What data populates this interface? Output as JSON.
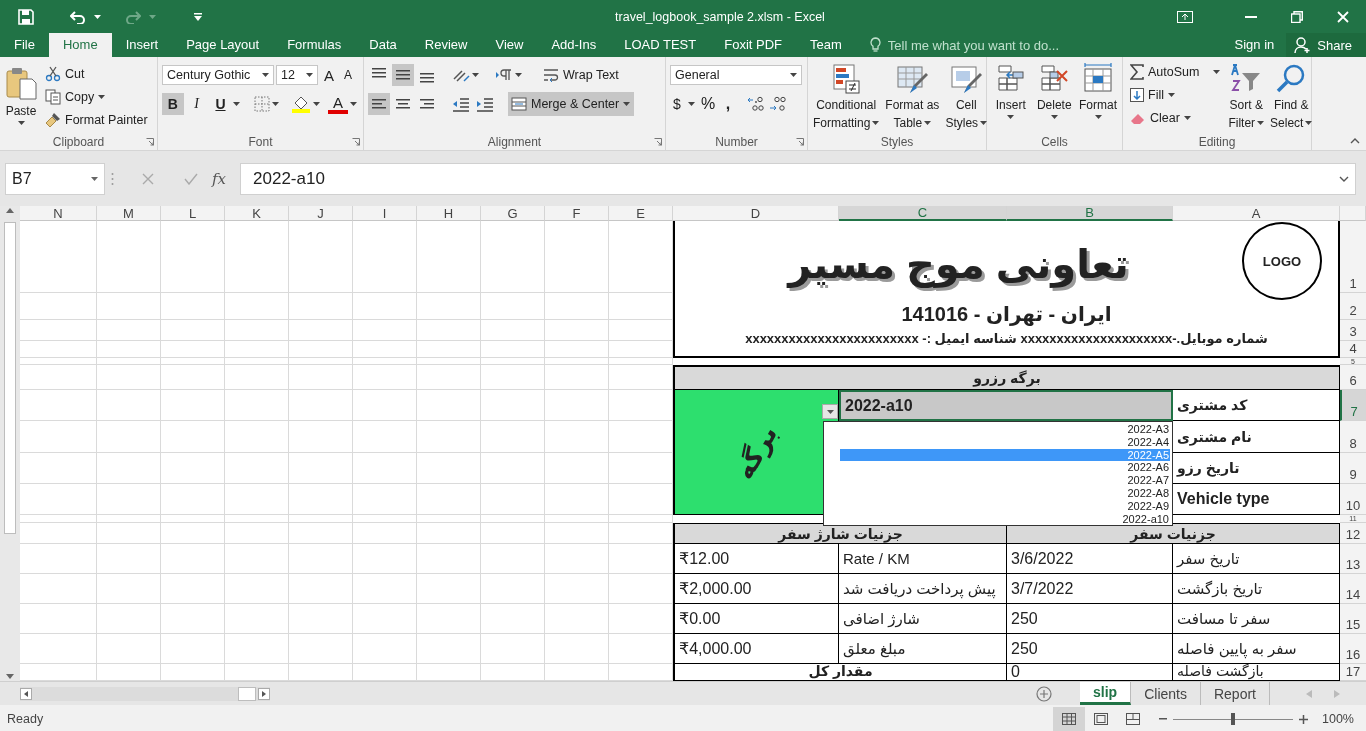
{
  "title_bar": {
    "title": "travel_logbook_sample 2.xlsm - Excel"
  },
  "menu_tabs": [
    {
      "label": "File",
      "selected": false
    },
    {
      "label": "Home",
      "selected": true
    },
    {
      "label": "Insert",
      "selected": false
    },
    {
      "label": "Page Layout",
      "selected": false
    },
    {
      "label": "Formulas",
      "selected": false
    },
    {
      "label": "Data",
      "selected": false
    },
    {
      "label": "Review",
      "selected": false
    },
    {
      "label": "View",
      "selected": false
    },
    {
      "label": "Add-Ins",
      "selected": false
    },
    {
      "label": "LOAD TEST",
      "selected": false
    },
    {
      "label": "Foxit PDF",
      "selected": false
    },
    {
      "label": "Team",
      "selected": false
    }
  ],
  "tell_me": {
    "placeholder": "Tell me what you want to do..."
  },
  "account": {
    "sign_in": "Sign in",
    "share": "Share"
  },
  "ribbon": {
    "clipboard": {
      "label": "Clipboard",
      "paste": "Paste",
      "cut": "Cut",
      "copy": "Copy",
      "format_painter": "Format Painter"
    },
    "font": {
      "label": "Font",
      "name": "Century Gothic",
      "size": "12",
      "grow": "A",
      "shrink": "A",
      "bold": "B",
      "italic": "I",
      "underline": "U",
      "font_color": "A",
      "bold_on": true
    },
    "alignment": {
      "label": "Alignment",
      "wrap_text": "Wrap Text",
      "merge_center": "Merge & Center",
      "middle_on": true,
      "left_on": true,
      "merge_on": true
    },
    "number": {
      "label": "Number",
      "format": "General",
      "currency": "$",
      "percent": "%",
      "comma": ","
    },
    "styles": {
      "label": "Styles",
      "buttons": [
        {
          "kind": "conditional",
          "line1": "Conditional",
          "line2": "Formatting"
        },
        {
          "kind": "table",
          "line1": "Format as",
          "line2": "Table"
        },
        {
          "kind": "cell_styles",
          "line1": "Cell",
          "line2": "Styles"
        }
      ]
    },
    "cells": {
      "label": "Cells",
      "buttons": [
        {
          "kind": "insert",
          "label": "Insert"
        },
        {
          "kind": "delete",
          "label": "Delete"
        },
        {
          "kind": "format",
          "label": "Format"
        }
      ]
    },
    "editing": {
      "label": "Editing",
      "autosum": "AutoSum",
      "fill": "Fill",
      "clear": "Clear",
      "sort_line1": "Sort &",
      "sort_line2": "Filter",
      "find_line1": "Find &",
      "find_line2": "Select"
    }
  },
  "formula_bar": {
    "name_box": "B7",
    "fx": "fx",
    "value": "2022-a10"
  },
  "sheet": {
    "columns": [
      {
        "label": "N",
        "selected": false
      },
      {
        "label": "M",
        "selected": false
      },
      {
        "label": "L",
        "selected": false
      },
      {
        "label": "K",
        "selected": false
      },
      {
        "label": "J",
        "selected": false
      },
      {
        "label": "I",
        "selected": false
      },
      {
        "label": "H",
        "selected": false
      },
      {
        "label": "G",
        "selected": false
      },
      {
        "label": "F",
        "selected": false
      },
      {
        "label": "E",
        "selected": false
      },
      {
        "label": "D",
        "selected": false
      },
      {
        "label": "C",
        "selected": true
      },
      {
        "label": "B",
        "selected": true
      },
      {
        "label": "A",
        "selected": false
      }
    ],
    "rows": [
      {
        "label": "1",
        "selected": false
      },
      {
        "label": "2",
        "selected": false
      },
      {
        "label": "3",
        "selected": false
      },
      {
        "label": "4",
        "selected": false
      },
      {
        "label": "5",
        "selected": false
      },
      {
        "label": "6",
        "selected": false
      },
      {
        "label": "7",
        "selected": true
      },
      {
        "label": "8",
        "selected": false
      },
      {
        "label": "9",
        "selected": false
      },
      {
        "label": "10",
        "selected": false
      },
      {
        "label": "11",
        "selected": false
      },
      {
        "label": "12",
        "selected": false
      },
      {
        "label": "13",
        "selected": false
      },
      {
        "label": "14",
        "selected": false
      },
      {
        "label": "15",
        "selected": false
      },
      {
        "label": "16",
        "selected": false
      },
      {
        "label": "17",
        "selected": false
      }
    ]
  },
  "slip": {
    "logo": "LOGO",
    "company_name": "تعاونی موج مسیر",
    "address": "ایران - تهران - 141016",
    "contact": "شماره موبایل.-xxxxxxxxxxxxxxxxxxxxx شناسه ایمیل :- xxxxxxxxxxxxxxxxxxxxxxxx",
    "section_title": "برگه رزرو",
    "customer_code": "2022-a10",
    "fields": [
      {
        "label": "کد مشتری"
      },
      {
        "label": "نام مشتری"
      },
      {
        "label": "تاریخ رزو"
      },
      {
        "label": "Vehicle type"
      }
    ],
    "stamp": "برگه",
    "trip_header": "جزنیات سفر",
    "charges_header": "جزنیات شارژ سفر",
    "details": [
      {
        "trip_label": "تاریخ سفر",
        "trip_value": "3/6/2022",
        "charge_label": "Rate / KM",
        "charge_value": "₹12.00"
      },
      {
        "trip_label": "تاریخ بازگشت",
        "trip_value": "3/7/2022",
        "charge_label": "پیش پرداخت دریافت شد",
        "charge_value": "₹2,000.00"
      },
      {
        "trip_label": "سفر تا مسافت",
        "trip_value": "250",
        "charge_label": "شارژ اضافی",
        "charge_value": "₹0.00"
      },
      {
        "trip_label": "سفر به پایین فاصله",
        "trip_value": "250",
        "charge_label": "مبلغ معلق",
        "charge_value": "₹4,000.00"
      }
    ],
    "last_row": {
      "trip_label": "بازگشت فاصله",
      "trip_value": "0",
      "total_label": "مقدار کل"
    }
  },
  "dropdown": {
    "items": [
      {
        "label": "2022-A3",
        "selected": false
      },
      {
        "label": "2022-A4",
        "selected": false
      },
      {
        "label": "2022-A5",
        "selected": true
      },
      {
        "label": "2022-A6",
        "selected": false
      },
      {
        "label": "2022-A7",
        "selected": false
      },
      {
        "label": "2022-A8",
        "selected": false
      },
      {
        "label": "2022-A9",
        "selected": false
      },
      {
        "label": "2022-a10",
        "selected": false
      }
    ]
  },
  "sheet_tabs": [
    {
      "label": "slip",
      "selected": true
    },
    {
      "label": "Clients",
      "selected": false
    },
    {
      "label": "Report",
      "selected": false
    }
  ],
  "status_bar": {
    "text": "Ready",
    "views": [
      {
        "kind": "normal",
        "selected": true
      },
      {
        "kind": "page_layout",
        "selected": false
      },
      {
        "kind": "page_break",
        "selected": false
      }
    ],
    "zoom": {
      "level": 0.5,
      "reading": "100%"
    }
  }
}
